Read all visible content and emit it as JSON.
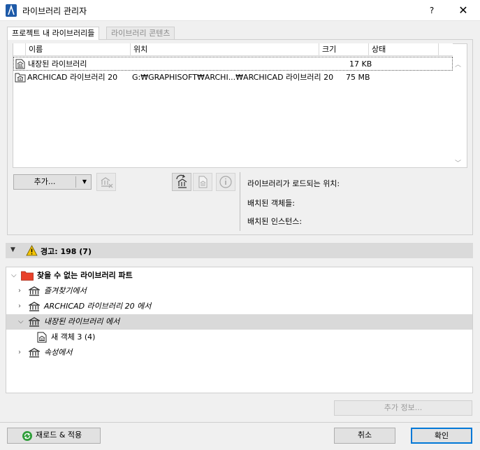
{
  "window": {
    "title": "라이브러리 관리자",
    "help": "?",
    "close": "✕"
  },
  "tabs": {
    "project_libraries": "프로젝트 내 라이브러리들",
    "library_contents": "라이브러리 콘텐츠"
  },
  "table": {
    "headers": {
      "name": "이름",
      "location": "위치",
      "size": "크기",
      "status": "상태"
    },
    "rows": [
      {
        "name": "내장된 라이브러리",
        "location": "",
        "size": "17 KB",
        "status": ""
      },
      {
        "name": "ARCHICAD 라이브러리 20",
        "location": "G:₩GRAPHISOFT₩ARCHI...₩ARCHICAD 라이브러리 20",
        "size": "75 MB",
        "status": ""
      }
    ]
  },
  "toolbar": {
    "add_label": "추가..."
  },
  "info": {
    "load_location": "라이브러리가 로드되는 위치:",
    "placed_objects": "배치된 객체들:",
    "placed_instances": "배치된 인스턴스:"
  },
  "warnings": {
    "label": "경고: 198 (7)"
  },
  "tree": {
    "root": "찾을 수 없는 라이브러리 파트",
    "items": [
      {
        "label": "즐겨찾기에서"
      },
      {
        "label": "ARCHICAD 라이브러리 20 에서"
      },
      {
        "label": "내장된 라이브러리 에서"
      },
      {
        "label": "새 객체 3 (4)"
      },
      {
        "label": "속성에서"
      }
    ]
  },
  "buttons": {
    "more_info": "추가 정보...",
    "reload_apply": "재로드 & 적용",
    "cancel": "취소",
    "ok": "확인"
  },
  "colors": {
    "folder_red": "#e8412a",
    "warning_yellow": "#f5c400",
    "selection": "#d9d9d9",
    "ok_border": "#0078d7"
  }
}
